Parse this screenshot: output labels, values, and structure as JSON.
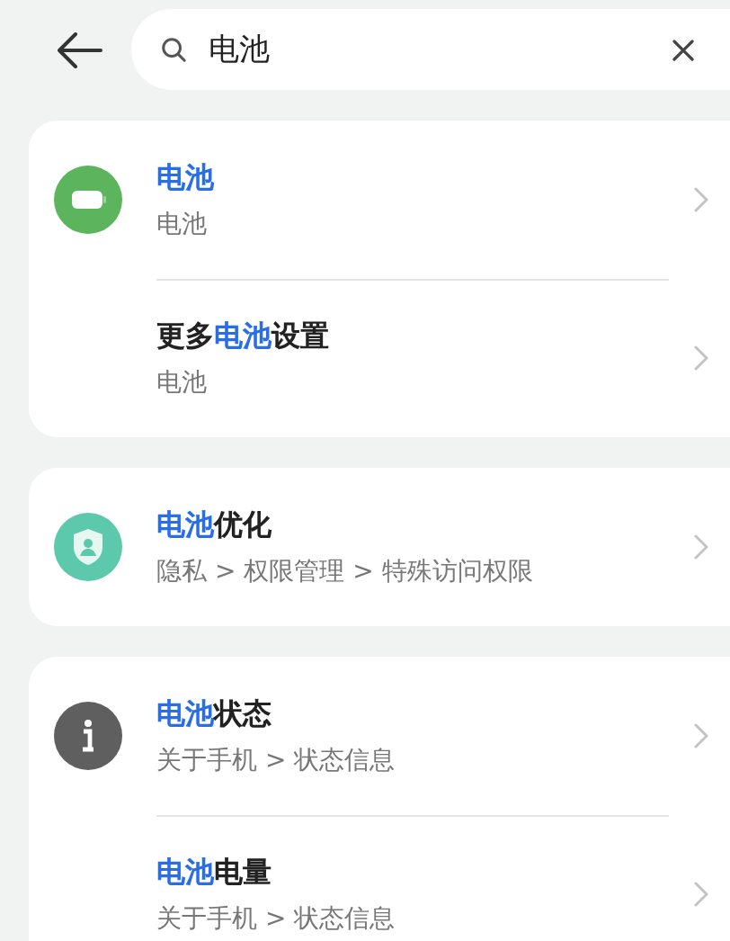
{
  "search": {
    "value": "电池"
  },
  "groups": [
    {
      "rows": [
        {
          "kind": "battery",
          "title": [
            {
              "text": "电池",
              "highlight": true
            }
          ],
          "path": "电池"
        },
        {
          "kind": "plain",
          "title": [
            {
              "text": "更多",
              "highlight": false
            },
            {
              "text": "电池",
              "highlight": true
            },
            {
              "text": "设置",
              "highlight": false
            }
          ],
          "path": "电池"
        }
      ]
    },
    {
      "rows": [
        {
          "kind": "shield",
          "title": [
            {
              "text": "电池",
              "highlight": true
            },
            {
              "text": "优化",
              "highlight": false
            }
          ],
          "path": "隐私 > 权限管理 > 特殊访问权限"
        }
      ]
    },
    {
      "rows": [
        {
          "kind": "info",
          "title": [
            {
              "text": "电池",
              "highlight": true
            },
            {
              "text": "状态",
              "highlight": false
            }
          ],
          "path": "关于手机 > 状态信息"
        },
        {
          "kind": "plain",
          "title": [
            {
              "text": "电池",
              "highlight": true
            },
            {
              "text": "电量",
              "highlight": false
            }
          ],
          "path": "关于手机 > 状态信息"
        }
      ]
    }
  ]
}
